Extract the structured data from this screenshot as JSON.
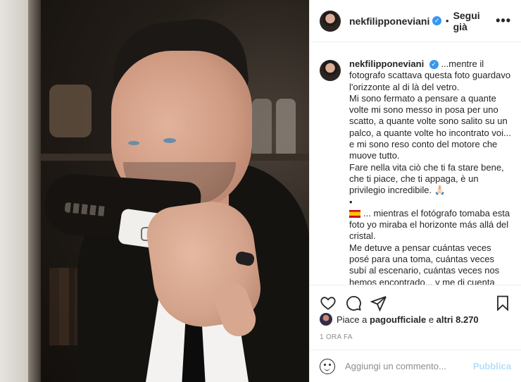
{
  "post": {
    "username": "nekfilipponeviani",
    "follow_label": "Segui già",
    "separator": "•",
    "more_label": "•••"
  },
  "caption": {
    "username": "nekfilipponeviani",
    "paragraphs": [
      "...mentre il fotografo scattava questa foto guardavo l'orizzonte al di là del vetro.",
      "Mi sono fermato a pensare a quante volte mi sono messo in posa per uno scatto, a quante volte sono salito su un palco, a quante volte ho incontrato voi... e mi sono reso conto del motore che muove tutto.",
      "Fare nella vita ciò che ti fa stare bene, che ti piace, che ti appaga, è un privilegio incredibile. 🙏🏻",
      "•",
      "... mientras el fotógrafo tomaba esta foto yo miraba el horizonte más allá del cristal.",
      "Me detuve a pensar cuántas veces posé para una toma, cuántas veces subí al escenario, cuántas veces nos hemos encontrado... y me di cuenta"
    ]
  },
  "likes": {
    "prefix": "Piace a",
    "user": "pagoufficiale",
    "conjunction": "e",
    "others": "altri 8.270"
  },
  "timestamp": "1 ORA FA",
  "comment": {
    "placeholder": "Aggiungi un commento...",
    "publish_label": "Pubblica"
  },
  "colors": {
    "accent": "#3897f0",
    "publish_disabled": "#b2dffc",
    "muted": "#8e8e8e"
  }
}
